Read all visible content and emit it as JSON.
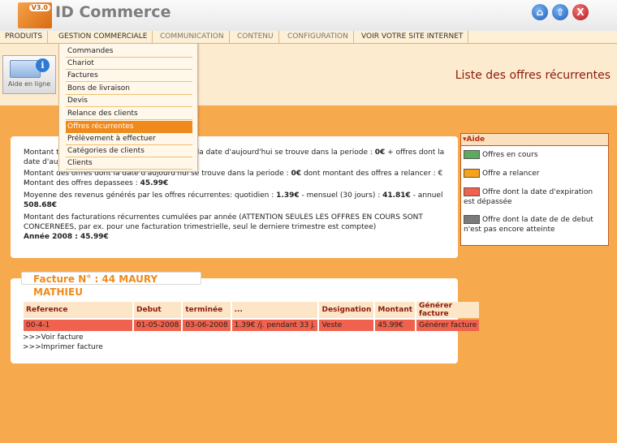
{
  "app": {
    "logo_text": "ID Commerce",
    "version_badge": "V3.0"
  },
  "header_icons": [
    {
      "name": "home-icon",
      "glyph": "⌂"
    },
    {
      "name": "up-icon",
      "glyph": "⇧"
    },
    {
      "name": "close-icon",
      "glyph": "X"
    }
  ],
  "menu": [
    "PRODUITS",
    "GESTION COMMERCIALE",
    "COMMUNICATION",
    "CONTENU",
    "CONFIGURATION",
    "VOIR VOTRE SITE INTERNET"
  ],
  "submenu": [
    "Commandes",
    "Chariot",
    "Factures",
    "Bons de livraison",
    "Devis",
    "Relance des clients",
    "Offres récurrentes",
    "Prélèvement à effectuer",
    "Catégories de clients",
    "Clients"
  ],
  "submenu_selected": "Offres récurrentes",
  "aide_button": "Aide en ligne",
  "page_title": "Liste des offres récurrentes",
  "info": {
    "line1a": "Montant t",
    "line1b": "nt la date d'aujourd'hui se trouve dans la periode : ",
    "line1c": "0€",
    "line1d": " + offres dont la",
    "line2": "date d'auj",
    "line3a": "Montant des offres dont la date d'aujourd'hui se trouve dans la periode : ",
    "line3b": "0€",
    "line3c": " dont montant des offres a relancer : € -",
    "line4a": "Montant des offres depassees : ",
    "line4b": "45.99€",
    "line5a": "Moyenne des revenus générés par les offres récurrentes: quotidien : ",
    "line5b": "1.39€",
    "line5c": " - mensuel (30 jours) : ",
    "line5d": "41.81€",
    "line5e": " - annuel :",
    "line6": "508.68€",
    "line7": "Montant des facturations récurrentes cumulées par année (ATTENTION SEULES LES OFFRES EN COURS SONT",
    "line8": "CONCERNEES, par ex. pour une facturation trimestrielle, seul le derniere trimestre est comptee)",
    "line9": "Année 2008 : 45.99€"
  },
  "legend": {
    "title": "▾Aide",
    "items": [
      {
        "label": "Offres en cours",
        "color": "#5fa85f"
      },
      {
        "label": "Offre a relancer",
        "color": "#f7a21b"
      },
      {
        "label": "Offre dont la date d'expiration est dépassée",
        "color": "#f0624d"
      },
      {
        "label": "Offre dont la date de de debut n'est pas encore atteinte",
        "color": "#7a7a7a"
      }
    ]
  },
  "facture": {
    "title": "Facture N° : 44 MAURY MATHIEU",
    "columns": [
      "Reference",
      "Debut",
      "terminée",
      "...",
      "Designation",
      "Montant",
      "Générer facture"
    ],
    "rows": [
      [
        "00-4-1",
        "01-05-2008",
        "03-06-2008",
        "1.39€ /j. pendant 33 j.",
        "Veste",
        "45.99€",
        "Générer facture"
      ]
    ],
    "links": [
      ">>>Voir facture",
      ">>>Imprimer facture"
    ]
  }
}
